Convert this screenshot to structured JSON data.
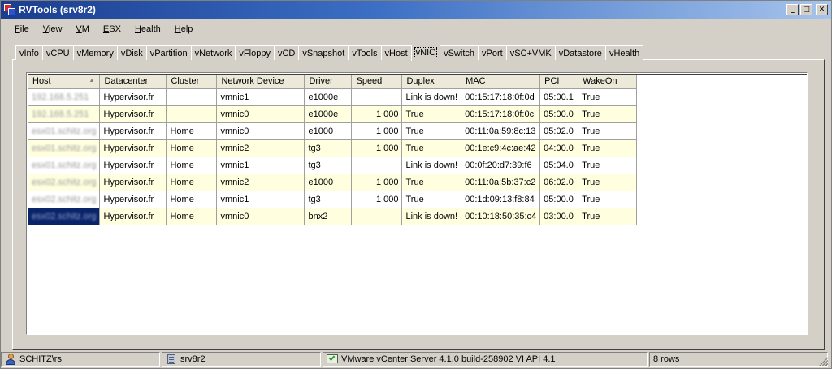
{
  "window": {
    "title": "RVTools (srv8r2)"
  },
  "menu": [
    "File",
    "View",
    "VM",
    "ESX",
    "Health",
    "Help"
  ],
  "tabs": [
    "vInfo",
    "vCPU",
    "vMemory",
    "vDisk",
    "vPartition",
    "vNetwork",
    "vFloppy",
    "vCD",
    "vSnapshot",
    "vTools",
    "vHost",
    "vNIC",
    "vSwitch",
    "vPort",
    "vSC+VMK",
    "vDatastore",
    "vHealth"
  ],
  "active_tab": "vNIC",
  "table": {
    "columns": [
      "Host",
      "Datacenter",
      "Cluster",
      "Network Device",
      "Driver",
      "Speed",
      "Duplex",
      "MAC",
      "PCI",
      "WakeOn"
    ],
    "rows": [
      [
        "192.168.5.251",
        "Hypervisor.fr",
        "",
        "vmnic1",
        "e1000e",
        "",
        "Link is down!",
        "00:15:17:18:0f:0d",
        "05:00.1",
        "True"
      ],
      [
        "192.168.5.251",
        "Hypervisor.fr",
        "",
        "vmnic0",
        "e1000e",
        "1 000",
        "True",
        "00:15:17:18:0f:0c",
        "05:00.0",
        "True"
      ],
      [
        "esx01.schitz.org",
        "Hypervisor.fr",
        "Home",
        "vmnic0",
        "e1000",
        "1 000",
        "True",
        "00:11:0a:59:8c:13",
        "05:02.0",
        "True"
      ],
      [
        "esx01.schitz.org",
        "Hypervisor.fr",
        "Home",
        "vmnic2",
        "tg3",
        "1 000",
        "True",
        "00:1e:c9:4c:ae:42",
        "04:00.0",
        "True"
      ],
      [
        "esx01.schitz.org",
        "Hypervisor.fr",
        "Home",
        "vmnic1",
        "tg3",
        "",
        "Link is down!",
        "00:0f:20:d7:39:f6",
        "05:04.0",
        "True"
      ],
      [
        "esx02.schitz.org",
        "Hypervisor.fr",
        "Home",
        "vmnic2",
        "e1000",
        "1 000",
        "True",
        "00:11:0a:5b:37:c2",
        "06:02.0",
        "True"
      ],
      [
        "esx02.schitz.org",
        "Hypervisor.fr",
        "Home",
        "vmnic1",
        "tg3",
        "1 000",
        "True",
        "00:1d:09:13:f8:84",
        "05:00.0",
        "True"
      ],
      [
        "esx02.schitz.org",
        "Hypervisor.fr",
        "Home",
        "vmnic0",
        "bnx2",
        "",
        "Link is down!",
        "00:10:18:50:35:c4",
        "03:00.0",
        "True"
      ]
    ],
    "selected_row": 7
  },
  "status": {
    "user": "SCHITZ\\rs",
    "server": "srv8r2",
    "vcenter": "VMware vCenter Server 4.1.0 build-258902  VI API 4.1",
    "rows": "8 rows"
  },
  "icons": {
    "app": "rvtools-app-icon",
    "user": "user-icon",
    "server": "server-icon",
    "vcenter": "vcenter-connection-icon"
  }
}
